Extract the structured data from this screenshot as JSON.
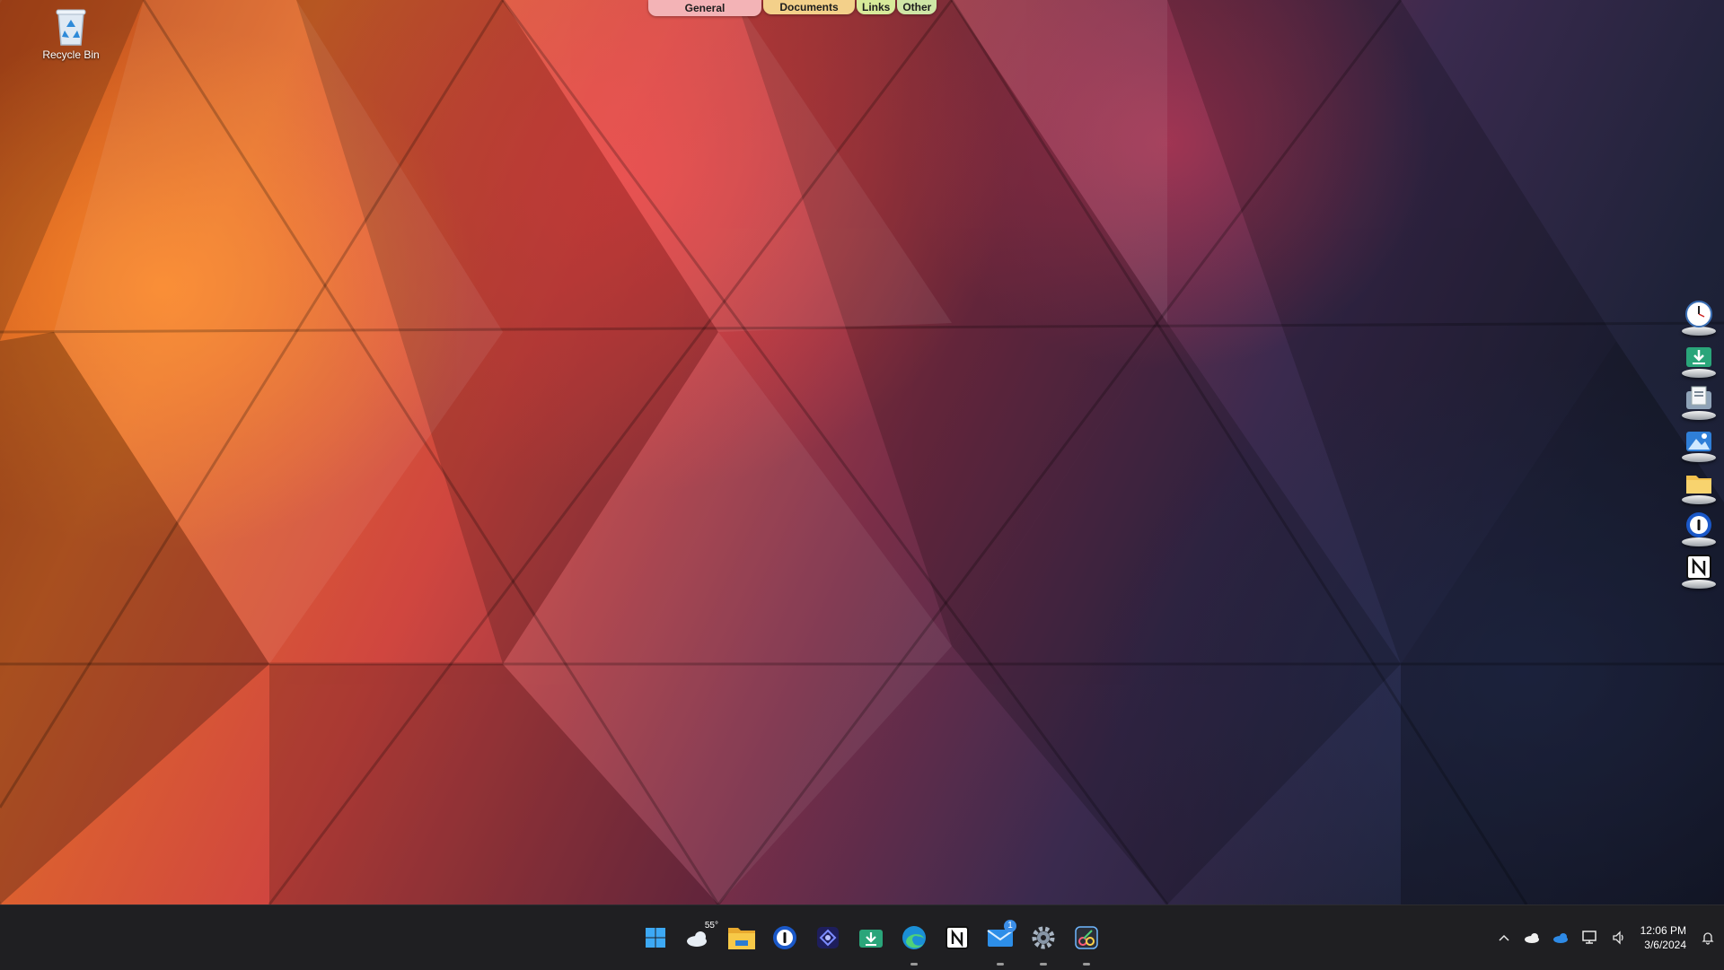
{
  "desktop": {
    "icons": [
      {
        "label": "Recycle Bin"
      }
    ]
  },
  "fences": {
    "tabs": [
      {
        "label": "General",
        "color": "#f3b3b6"
      },
      {
        "label": "Documents",
        "color": "#f3d08a"
      },
      {
        "label": "Links",
        "color": "#d8ea9a"
      },
      {
        "label": "Other",
        "color": "#cfe6a6"
      }
    ]
  },
  "dock": {
    "items": [
      {
        "icon": "clock-icon"
      },
      {
        "icon": "downloads-icon"
      },
      {
        "icon": "documents-icon"
      },
      {
        "icon": "pictures-icon"
      },
      {
        "icon": "folder-icon"
      },
      {
        "icon": "1password-icon"
      },
      {
        "icon": "notion-icon"
      }
    ]
  },
  "taskbar": {
    "weather_temp": "55°",
    "mail_badge": "1",
    "apps": [
      {
        "icon": "windows-start-icon"
      },
      {
        "icon": "weather-icon"
      },
      {
        "icon": "file-explorer-icon"
      },
      {
        "icon": "1password-icon"
      },
      {
        "icon": "app-icon"
      },
      {
        "icon": "downloads-icon"
      },
      {
        "icon": "edge-icon"
      },
      {
        "icon": "notion-icon"
      },
      {
        "icon": "mail-icon"
      },
      {
        "icon": "settings-icon"
      },
      {
        "icon": "snipping-tool-icon"
      }
    ]
  },
  "tray": {
    "time": "12:06 PM",
    "date": "3/6/2024"
  },
  "colors": {
    "taskbar_bg": "#1f1f22",
    "accent_blue": "#3b8ee8"
  }
}
